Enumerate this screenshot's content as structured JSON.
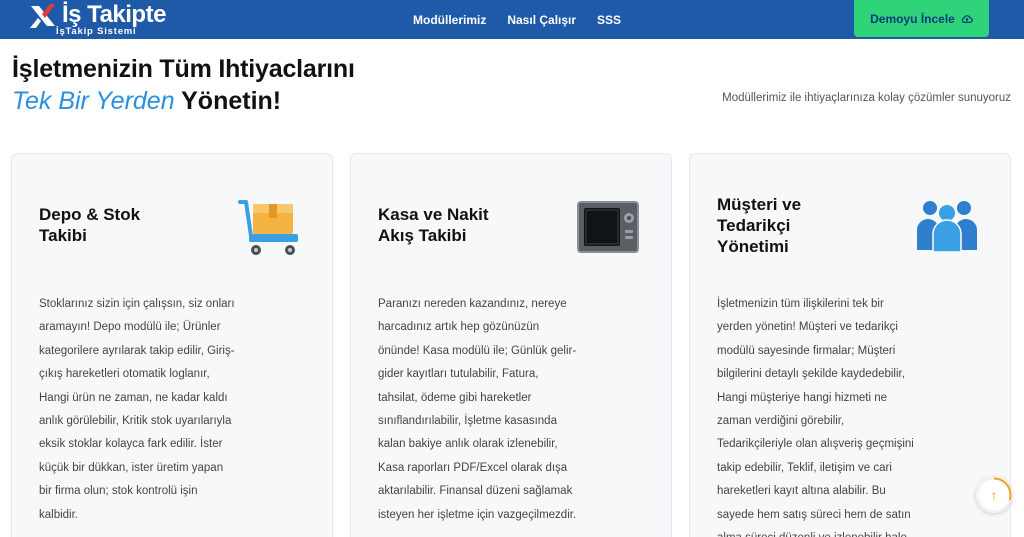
{
  "navbar": {
    "logo_text": "İş Takipte",
    "logo_sub": "İşTakip Sistemi",
    "links": [
      {
        "label": "Modüllerimiz"
      },
      {
        "label": "Nasıl Çalışır"
      },
      {
        "label": "SSS"
      }
    ],
    "demo_button": "Demoyu İncele",
    "demo_button_icon": "cloud-icon"
  },
  "hero": {
    "line1": "İşletmenizin Tüm Ihtiyaclarını",
    "line2_accent": "Tek Bir Yerden",
    "line2_rest": " Yönetin!",
    "subtitle": "Modüllerimiz ile ihtiyaçlarınıza kolay çözümler sunuyoruz"
  },
  "cards": [
    {
      "title_lines": [
        "Depo & Stok",
        "Takibi"
      ],
      "icon": "cart-box-icon",
      "text_lines": [
        "Stoklarınız sizin için çalışsın, siz onları",
        "aramayın! Depo modülü ile; Ürünler",
        "kategorilere ayrılarak takip edilir, Giriş-",
        "çıkış hareketleri otomatik loglanır,",
        "Hangi ürün ne zaman, ne kadar kaldı",
        "anlık görülebilir, Kritik stok uyarılarıyla",
        "eksik stoklar kolayca fark edilir. İster",
        "küçük bir dükkan, ister üretim yapan",
        "bir firma olun; stok kontrolü işin",
        "kalbidir."
      ]
    },
    {
      "title_lines": [
        "Kasa ve Nakit",
        "Akış Takibi"
      ],
      "icon": "safe-icon",
      "text_lines": [
        "Paranızı nereden kazandınız, nereye",
        "harcadınız artık hep gözünüzün",
        "önünde! Kasa modülü ile; Günlük gelir-",
        "gider kayıtları tutulabilir, Fatura,",
        "tahsilat, ödeme gibi hareketler",
        "sınıflandırılabilir, İşletme kasasında",
        "kalan bakiye anlık olarak izlenebilir,",
        "Kasa raporları PDF/Excel olarak dışa",
        "aktarılabilir. Finansal düzeni sağlamak",
        "isteyen her işletme için vazgeçilmezdir."
      ]
    },
    {
      "title_lines": [
        "Müşteri ve",
        "Tedarikçi",
        "Yönetimi"
      ],
      "icon": "people-group-icon",
      "text_lines": [
        "İşletmenizin tüm ilişkilerini tek bir",
        "yerden yönetin! Müşteri ve tedarikçi",
        "modülü sayesinde firmalar; Müşteri",
        "bilgilerini detaylı şekilde kaydedebilir,",
        "Hangi müşteriye hangi hizmeti ne",
        "zaman verdiğini görebilir,",
        "Tedarikçileriyle olan alışveriş geçmişini",
        "takip edebilir, Teklif, iletişim ve cari",
        "hareketleri kayıt altına alabilir. Bu",
        "sayede hem satış süreci hem de satın",
        "alma süreci düzenli ve izlenebilir hale"
      ]
    }
  ],
  "scroll_top": {
    "icon": "arrow-up-icon",
    "glyph": "↑",
    "progress": 0.3
  }
}
